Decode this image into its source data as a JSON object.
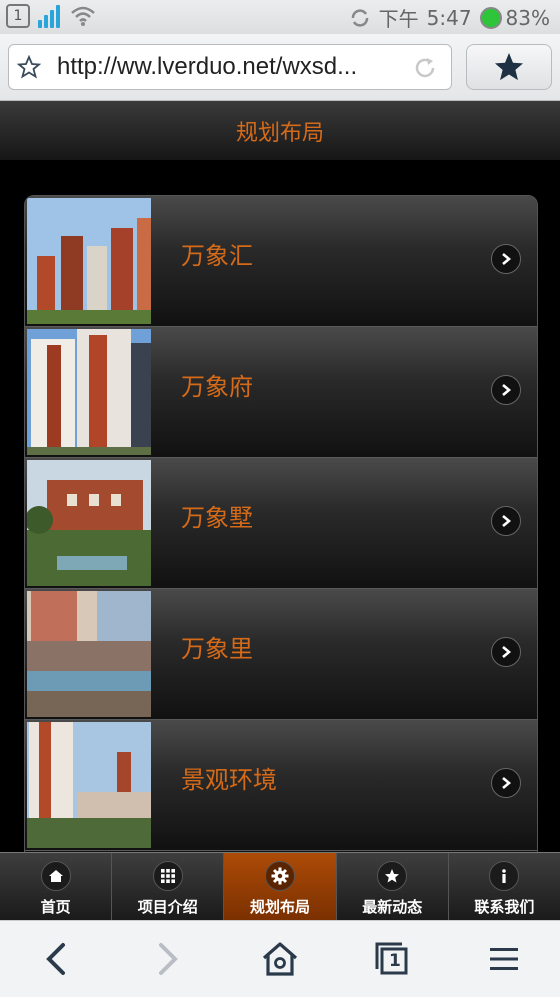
{
  "status_bar": {
    "sim_slot": "1",
    "time_prefix": "下午",
    "time": "5:47",
    "battery": "83%"
  },
  "address_bar": {
    "url": "http://ww.lverduo.net/wxsd..."
  },
  "page": {
    "title": "规划布局",
    "items": [
      {
        "label": "万象汇"
      },
      {
        "label": "万象府"
      },
      {
        "label": "万象墅"
      },
      {
        "label": "万象里"
      },
      {
        "label": "景观环境"
      }
    ]
  },
  "tabbar": {
    "items": [
      {
        "label": "首页",
        "icon": "home-icon"
      },
      {
        "label": "项目介绍",
        "icon": "grid-icon"
      },
      {
        "label": "规划布局",
        "icon": "gear-icon",
        "active": true
      },
      {
        "label": "最新动态",
        "icon": "star-icon"
      },
      {
        "label": "联系我们",
        "icon": "info-icon"
      }
    ]
  },
  "browser_nav": {
    "tab_count": "1"
  },
  "colors": {
    "accent": "#d56a18",
    "active_tab": "#9a4006",
    "battery": "#2ec53b"
  }
}
